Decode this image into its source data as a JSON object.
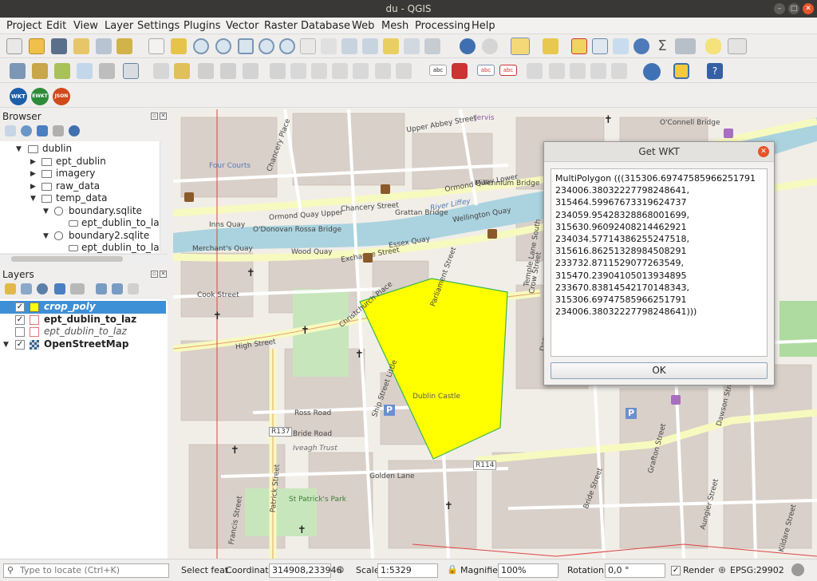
{
  "window": {
    "title": "du - QGIS"
  },
  "menu": [
    "Project",
    "Edit",
    "View",
    "Layer",
    "Settings",
    "Plugins",
    "Vector",
    "Raster",
    "Database",
    "Web",
    "Mesh",
    "Processing",
    "Help"
  ],
  "plugins_toolbar": [
    {
      "label": "WKT",
      "color": "#1f5fa8"
    },
    {
      "label": "EWKT",
      "color": "#2e8b3a"
    },
    {
      "label": "JSON",
      "color": "#d0491b"
    }
  ],
  "browser": {
    "title": "Browser",
    "items": [
      {
        "label": "dublin",
        "level": 1,
        "expanded": true
      },
      {
        "label": "ept_dublin",
        "level": 2,
        "expanded": false
      },
      {
        "label": "imagery",
        "level": 2,
        "expanded": false
      },
      {
        "label": "raw_data",
        "level": 2,
        "expanded": false
      },
      {
        "label": "temp_data",
        "level": 2,
        "expanded": true
      },
      {
        "label": "boundary.sqlite",
        "level": 3,
        "expanded": true
      },
      {
        "label": "ept_dublin_to_laz",
        "level": 4
      },
      {
        "label": "boundary2.sqlite",
        "level": 3,
        "expanded": true
      },
      {
        "label": "ept_dublin_to_laz",
        "level": 4
      }
    ]
  },
  "layers": {
    "title": "Layers",
    "items": [
      {
        "label": "crop_poly",
        "checked": true,
        "selected": true,
        "style": "bold-italic",
        "swatch": "#ffff00"
      },
      {
        "label": "ept_dublin_to_laz",
        "checked": true,
        "selected": false,
        "style": "bold",
        "swatch": "#ffffff"
      },
      {
        "label": "ept_dublin_to_laz",
        "checked": false,
        "selected": false,
        "style": "italic",
        "swatch": "#ffffff"
      },
      {
        "label": "OpenStreetMap",
        "checked": true,
        "selected": false,
        "style": "bold",
        "swatch": "grid"
      }
    ]
  },
  "dialog": {
    "title": "Get WKT",
    "text": "MultiPolygon (((315306.69747585966251791\n234006.38032227798248641,\n315464.59967673319624737\n234059.95428328868001699,\n315630.96092408214462921\n234034.57714386255247518,\n315616.86251328984508291\n233732.8711529077263549,\n315470.23904105013934895\n233670.83814542170148343,\n315306.69747585966251791\n234006.38032227798248641)))",
    "ok_label": "OK"
  },
  "map_labels": [
    "Four Courts",
    "Ormond Quay Upper",
    "Ormond Quay Lower",
    "Grattan Bridge",
    "River Liffey",
    "Essex Quay",
    "Wellington Quay",
    "Wood Quay",
    "Merchant's Quay",
    "O'Donovan Rossa Bridge",
    "Inns Quay",
    "Chancery Place",
    "Cook Street",
    "High Street",
    "Ship Street Little",
    "Golden Lane",
    "Bride Road",
    "Bride Street",
    "Iveagh Trust",
    "St Patrick's Park",
    "Dawson Street",
    "Grafton Street",
    "Kildare Street",
    "Crow Street",
    "Dame Street",
    "Temple Lane South",
    "Millennium Bridge",
    "O'Connell Bridge",
    "R137",
    "R114",
    "Ross Road",
    "Patrick Street",
    "Francis Street",
    "Christchurch Place",
    "Exchange Street",
    "Parliament Street",
    "Upper Abbey Street",
    "Jervis",
    "Aungier Street",
    "Dublin Castle",
    "Chancery Street"
  ],
  "statusbar": {
    "locate_placeholder": "Type to locate (Ctrl+K)",
    "select_feat": "Select feat",
    "coordinate_label": "Coordinate",
    "coordinate_value": "314908,233946",
    "scale_label": "Scale",
    "scale_value": "1:5329",
    "magnifier_label": "Magnifier",
    "magnifier_value": "100%",
    "rotation_label": "Rotation",
    "rotation_value": "0,0 °",
    "render_label": "Render",
    "render_checked": true,
    "crs": "EPSG:29902"
  }
}
